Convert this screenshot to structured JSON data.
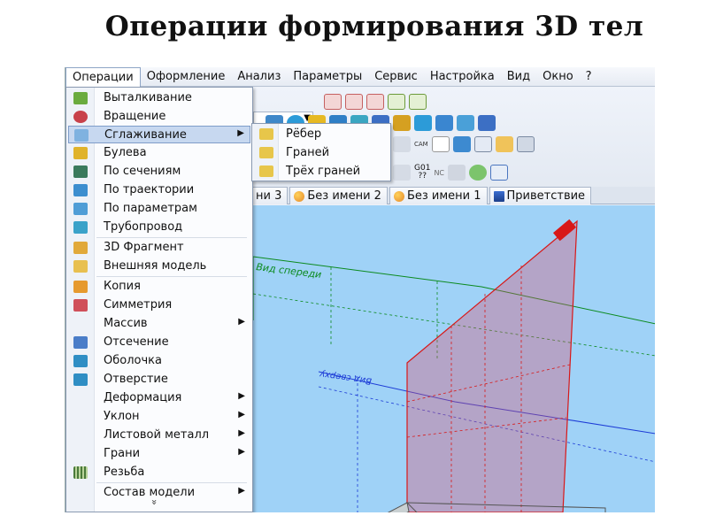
{
  "slide_title": "Операции формирования 3D тел",
  "menubar": {
    "items": [
      "Операции",
      "Оформление",
      "Анализ",
      "Параметры",
      "Сервис",
      "Настройка",
      "Вид",
      "Окно",
      "?"
    ]
  },
  "menu": {
    "items": [
      {
        "label": "Выталкивание",
        "icon": "extrude-icon"
      },
      {
        "label": "Вращение",
        "icon": "rotate-icon"
      },
      {
        "label": "Сглаживание",
        "icon": "smoothing-icon",
        "submenu": true,
        "highlighted": true
      },
      {
        "label": "Булева",
        "icon": "boolean-icon"
      },
      {
        "label": "По сечениям",
        "icon": "loft-icon"
      },
      {
        "label": "По траектории",
        "icon": "sweep-icon"
      },
      {
        "label": "По параметрам",
        "icon": "parametric-icon"
      },
      {
        "label": "Трубопровод",
        "icon": "pipe-icon"
      },
      {
        "label": "3D Фрагмент",
        "icon": "fragment-icon"
      },
      {
        "label": "Внешняя модель",
        "icon": "external-model-icon"
      },
      {
        "label": "Копия",
        "icon": "copy-icon"
      },
      {
        "label": "Симметрия",
        "icon": "mirror-icon"
      },
      {
        "label": "Массив",
        "icon": "",
        "submenu": true
      },
      {
        "label": "Отсечение",
        "icon": "cut-icon"
      },
      {
        "label": "Оболочка",
        "icon": "shell-icon"
      },
      {
        "label": "Отверстие",
        "icon": "hole-icon"
      },
      {
        "label": "Деформация",
        "icon": "",
        "submenu": true
      },
      {
        "label": "Уклон",
        "icon": "",
        "submenu": true
      },
      {
        "label": "Листовой металл",
        "icon": "",
        "submenu": true
      },
      {
        "label": "Грани",
        "icon": "",
        "submenu": true
      },
      {
        "label": "Резьба",
        "icon": "thread-icon"
      },
      {
        "label": "Состав модели",
        "icon": "",
        "submenu": true
      }
    ],
    "more_glyph": "»"
  },
  "submenu": {
    "items": [
      {
        "label": "Рёбер",
        "icon": "edges-icon"
      },
      {
        "label": "Граней",
        "icon": "faces-icon"
      },
      {
        "label": "Трёх граней",
        "icon": "three-faces-icon"
      }
    ]
  },
  "toolbar": {
    "gcode_label": "G01",
    "gcode_sub": "??",
    "nc_label": "NC",
    "cam_label": "CAM"
  },
  "tabs": [
    {
      "label": "ни 3",
      "icon": "doc-icon"
    },
    {
      "label": "Без имени 2",
      "icon": "doc-icon"
    },
    {
      "label": "Без имени 1",
      "icon": "doc-icon"
    },
    {
      "label": "Приветствие",
      "icon": "welcome-icon"
    }
  ],
  "viewport": {
    "front_plane_label": "Вид спереди",
    "top_plane_label": "Вид сверху",
    "colors": {
      "background": "#9fd2f7",
      "front_plane": "#0b8a1e",
      "top_plane": "#1c3bd6",
      "side_plane": "#d81818",
      "frame_fill": "#b5bec0"
    }
  }
}
